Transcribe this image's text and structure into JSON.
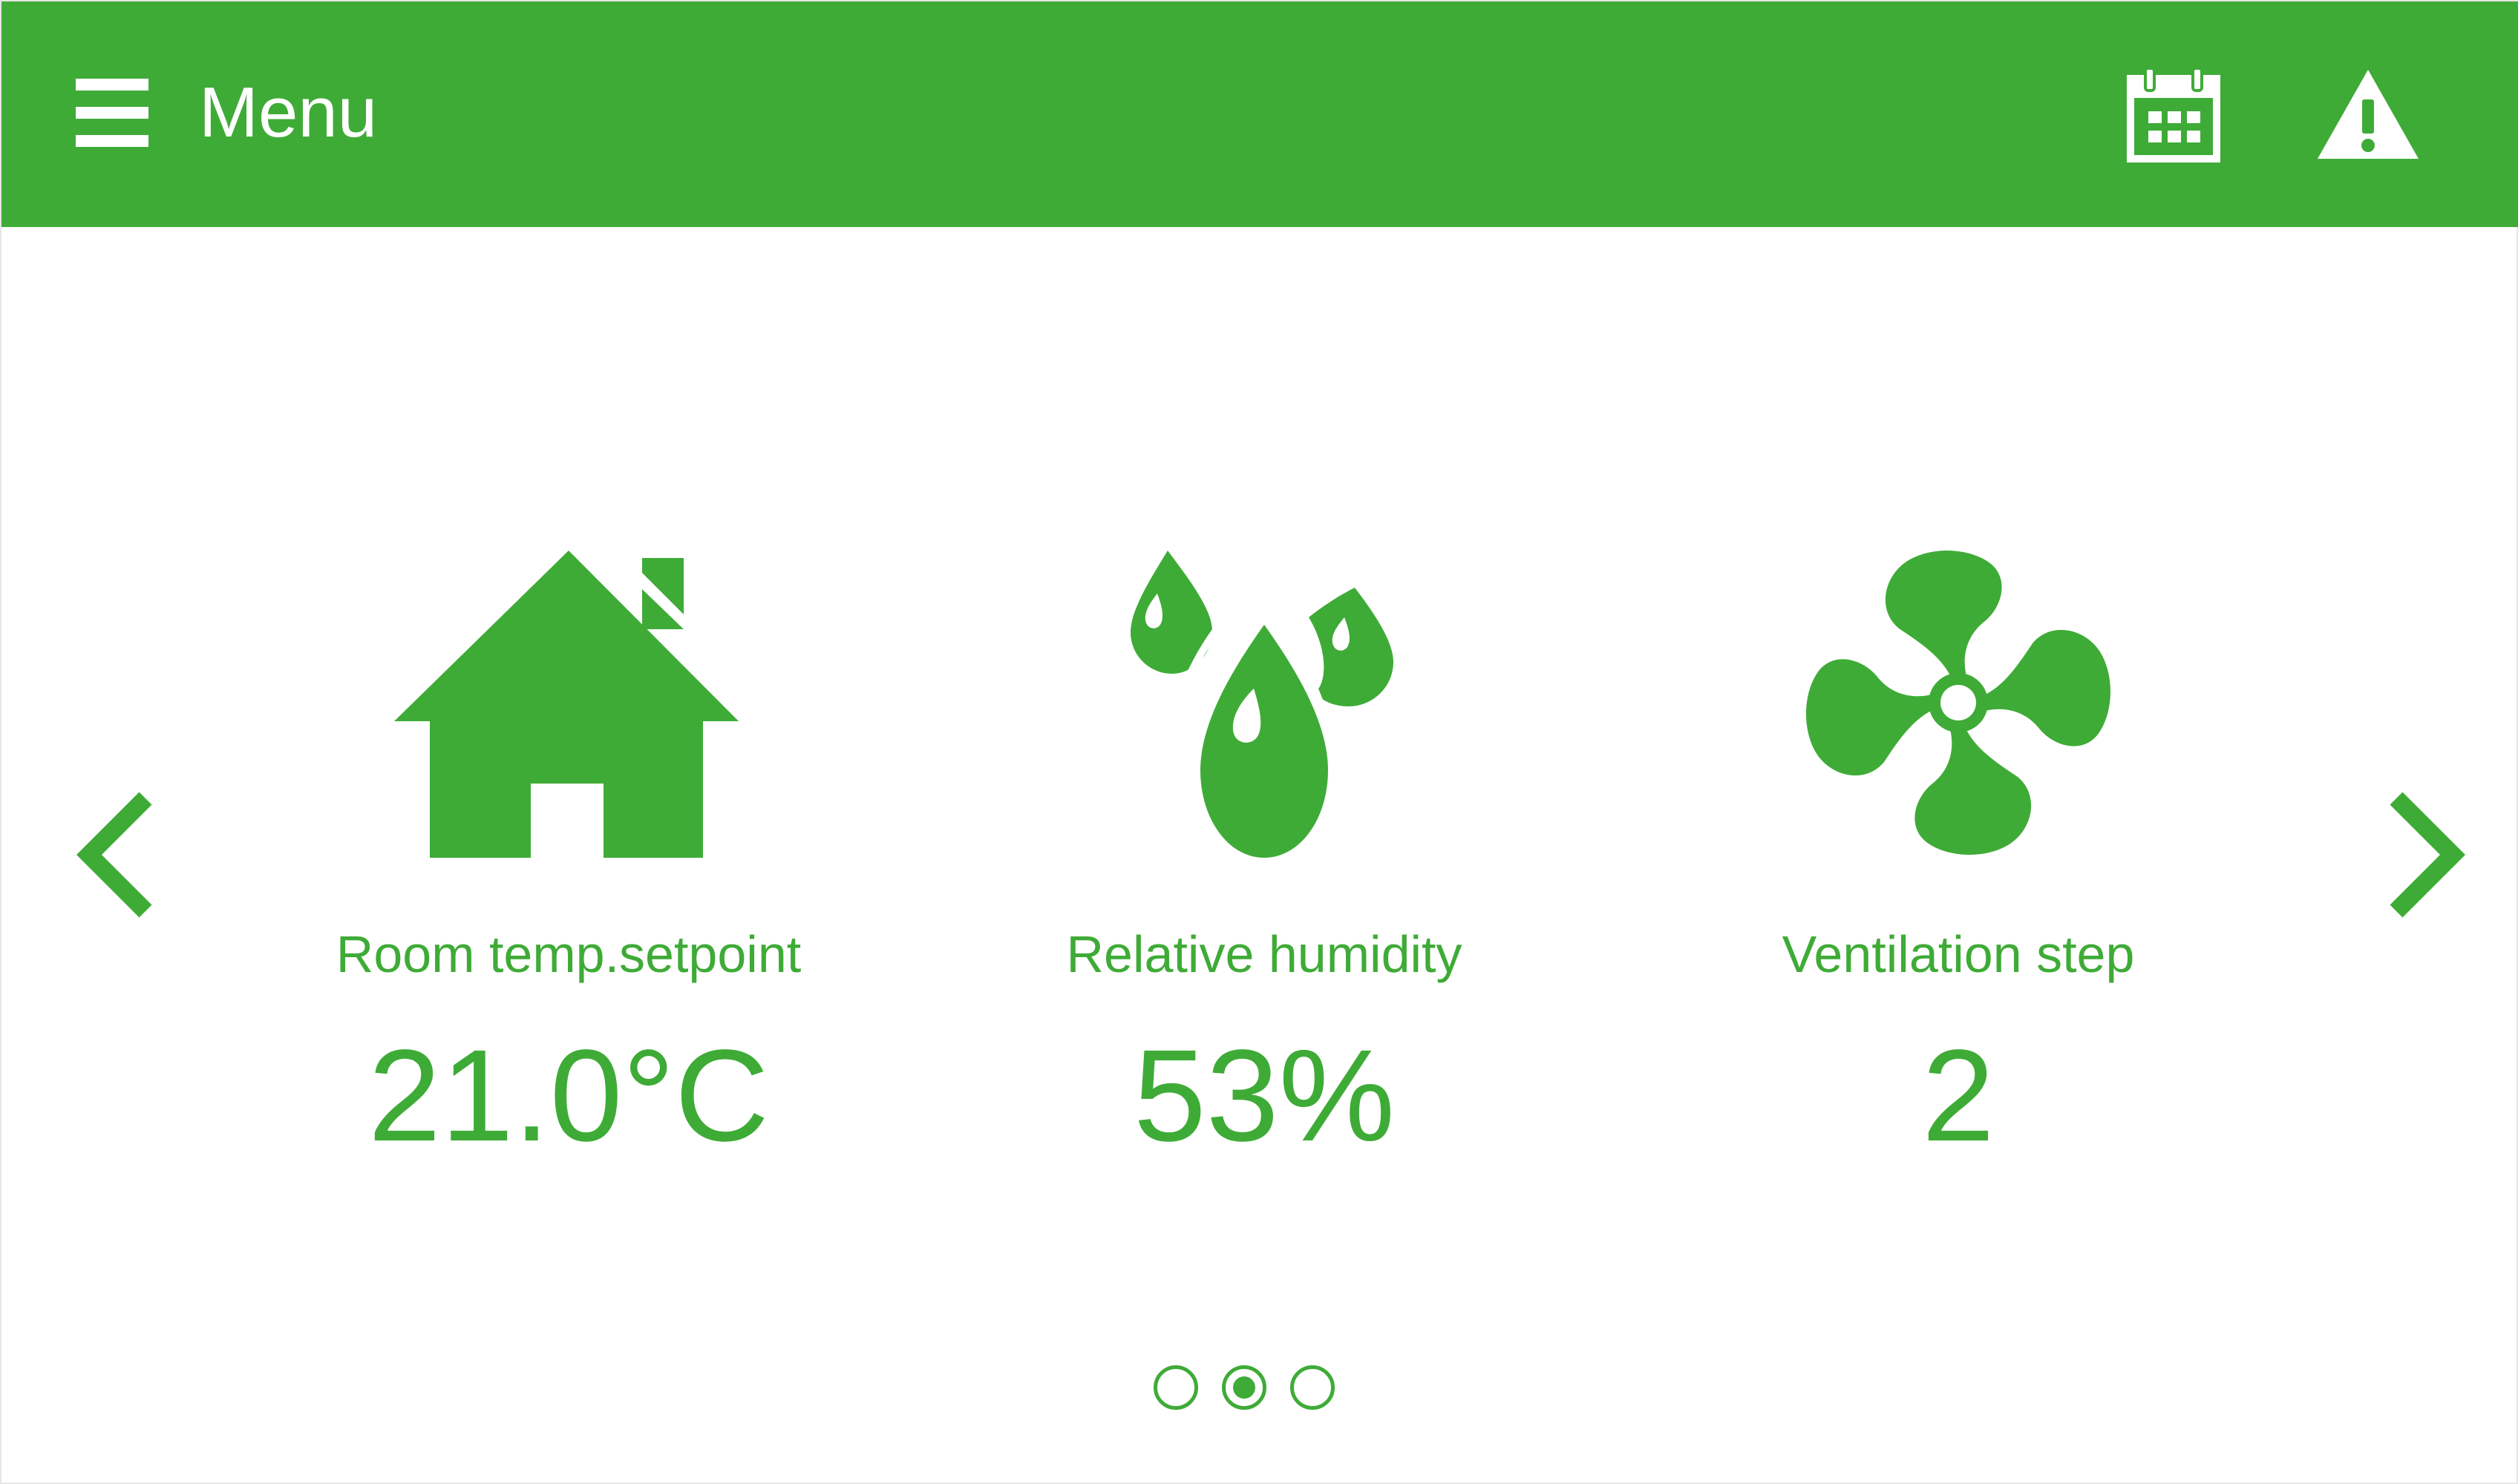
{
  "header": {
    "menu_label": "Menu",
    "menu_icon": "hamburger-icon",
    "calendar_icon": "calendar-icon",
    "alert_icon": "warning-icon",
    "bg_color": "#3fab37"
  },
  "tiles": [
    {
      "icon": "house-icon",
      "label": "Room temp.setpoint",
      "value": "21.0°C"
    },
    {
      "icon": "water-drops-icon",
      "label": "Relative humidity",
      "value": "53%"
    },
    {
      "icon": "fan-icon",
      "label": "Ventilation step",
      "value": "2"
    }
  ],
  "nav": {
    "prev_icon": "chevron-left-icon",
    "next_icon": "chevron-right-icon"
  },
  "pager": {
    "pages": 3,
    "active_index": 1
  },
  "colors": {
    "accent": "#3fab37",
    "background": "#ffffff"
  }
}
